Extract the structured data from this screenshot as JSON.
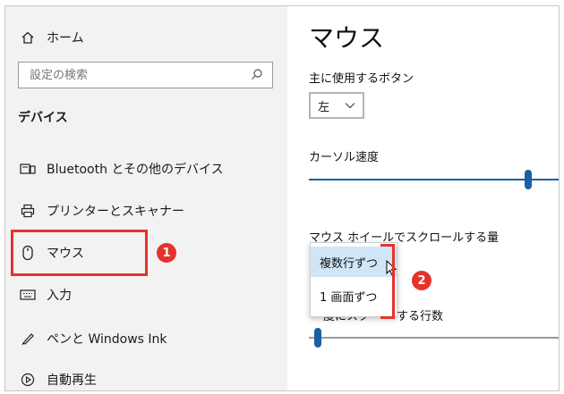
{
  "sidebar": {
    "home_label": "ホーム",
    "search_placeholder": "設定の検索",
    "section_title": "デバイス",
    "items": [
      {
        "label": "Bluetooth とその他のデバイス",
        "icon": "bluetooth-devices-icon"
      },
      {
        "label": "プリンターとスキャナー",
        "icon": "printer-icon"
      },
      {
        "label": "マウス",
        "icon": "mouse-icon"
      },
      {
        "label": "入力",
        "icon": "keyboard-icon"
      },
      {
        "label": "ペンと Windows Ink",
        "icon": "pen-icon"
      },
      {
        "label": "自動再生",
        "icon": "autoplay-icon"
      }
    ]
  },
  "main": {
    "title": "マウス",
    "primary_button_label": "主に使用するボタン",
    "primary_button_value": "左",
    "cursor_speed_label": "カーソル速度",
    "scroll_amount_label": "マウス ホイールでスクロールする量",
    "scroll_options": [
      "複数行ずつ",
      "1 画面ずつ"
    ],
    "selected_scroll_option": "複数行ずつ",
    "lines_label_visible": "度にスク",
    "lines_label_visible_end": "する行数"
  },
  "annotations": {
    "badge_1": "1",
    "badge_2": "2"
  },
  "colors": {
    "accent": "#1a5fa8",
    "highlight": "#e6322d",
    "selected_item_bg": "#cfe6f8"
  },
  "sliders": {
    "cursor_speed_fraction": 0.9,
    "scroll_lines_fraction": 0.03
  }
}
